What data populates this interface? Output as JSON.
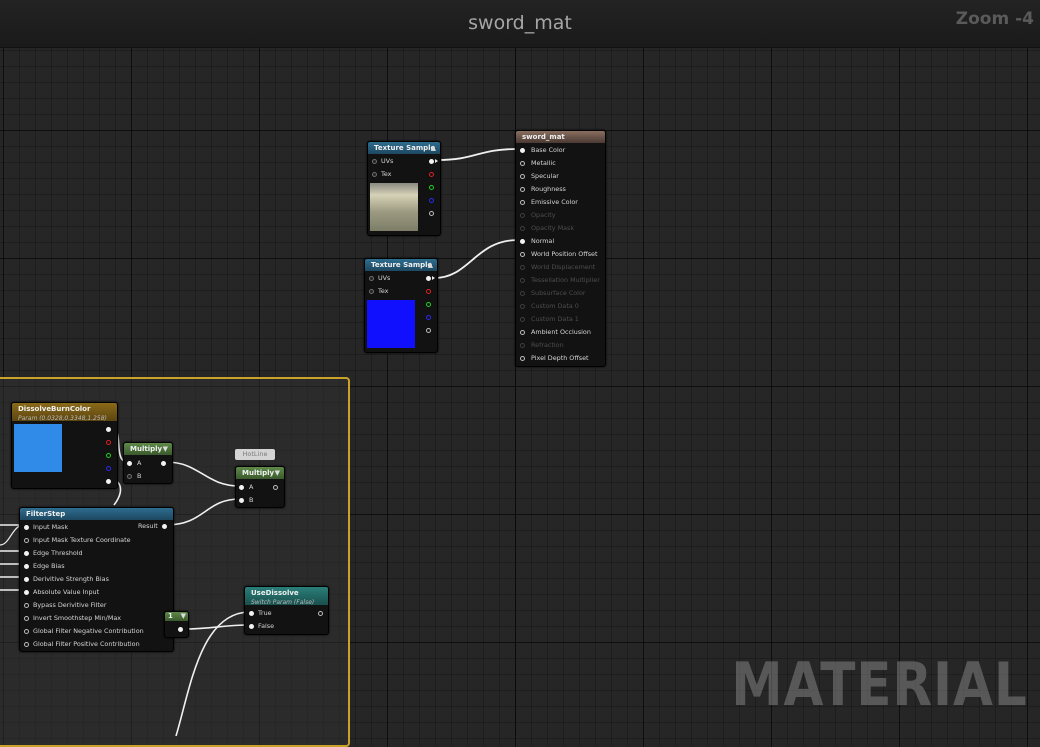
{
  "editor": {
    "title": "sword_mat",
    "zoom_label": "Zoom -4",
    "watermark": "MATERIAL"
  },
  "nodes": {
    "texture_sample_1": {
      "title": "Texture Sample",
      "pins": {
        "uvs": "UVs",
        "tex": "Tex"
      }
    },
    "texture_sample_2": {
      "title": "Texture Sample",
      "pins": {
        "uvs": "UVs",
        "tex": "Tex"
      }
    },
    "result_node": {
      "title": "sword_mat",
      "inputs": [
        {
          "label": "Base Color",
          "enabled": true
        },
        {
          "label": "Metallic",
          "enabled": true
        },
        {
          "label": "Specular",
          "enabled": true
        },
        {
          "label": "Roughness",
          "enabled": true
        },
        {
          "label": "Emissive Color",
          "enabled": true
        },
        {
          "label": "Opacity",
          "enabled": false
        },
        {
          "label": "Opacity Mask",
          "enabled": false
        },
        {
          "label": "Normal",
          "enabled": true
        },
        {
          "label": "World Position Offset",
          "enabled": true
        },
        {
          "label": "World Displacement",
          "enabled": false
        },
        {
          "label": "Tessellation Multiplier",
          "enabled": false
        },
        {
          "label": "Subsurface Color",
          "enabled": false
        },
        {
          "label": "Custom Data 0",
          "enabled": false
        },
        {
          "label": "Custom Data 1",
          "enabled": false
        },
        {
          "label": "Ambient Occlusion",
          "enabled": true
        },
        {
          "label": "Refraction",
          "enabled": false
        },
        {
          "label": "Pixel Depth Offset",
          "enabled": true
        }
      ]
    },
    "dissolve_burn_color": {
      "title": "DissolveBurnColor",
      "subtitle": "Param (0.0328,0.3348,1.258)",
      "swatch_color": "#2f8ae8"
    },
    "multiply_1": {
      "title": "Multiply",
      "pins": {
        "a": "A",
        "b": "B"
      }
    },
    "hotline": {
      "label": "HotLine"
    },
    "multiply_2": {
      "title": "Multiply",
      "pins": {
        "a": "A",
        "b": "B"
      }
    },
    "filter_step": {
      "title": "FilterStep",
      "output": "Result",
      "inputs": [
        "Input Mask",
        "Input Mask Texture Coordinate",
        "Edge Threshold",
        "Edge Bias",
        "Derivitive Strength Bias",
        "Absolute Value Input",
        "Bypass Derivitive Filter",
        "Invert Smoothstep Min/Max",
        "Global Filter Negative Contribution",
        "Global Filter Positive Contribution"
      ]
    },
    "constant_1": {
      "value": "1"
    },
    "use_dissolve": {
      "title": "UseDissolve",
      "subtitle": "Switch Param (False)",
      "pins": {
        "true": "True",
        "false": "False"
      }
    }
  },
  "colors": {
    "comment_border": "#c9a227",
    "texture_header": "#2f6d8f",
    "result_header": "#8a6f5f",
    "math_header": "#5e8a4a",
    "switch_header": "#2a7f7a",
    "param_header": "#8a6a1a"
  }
}
